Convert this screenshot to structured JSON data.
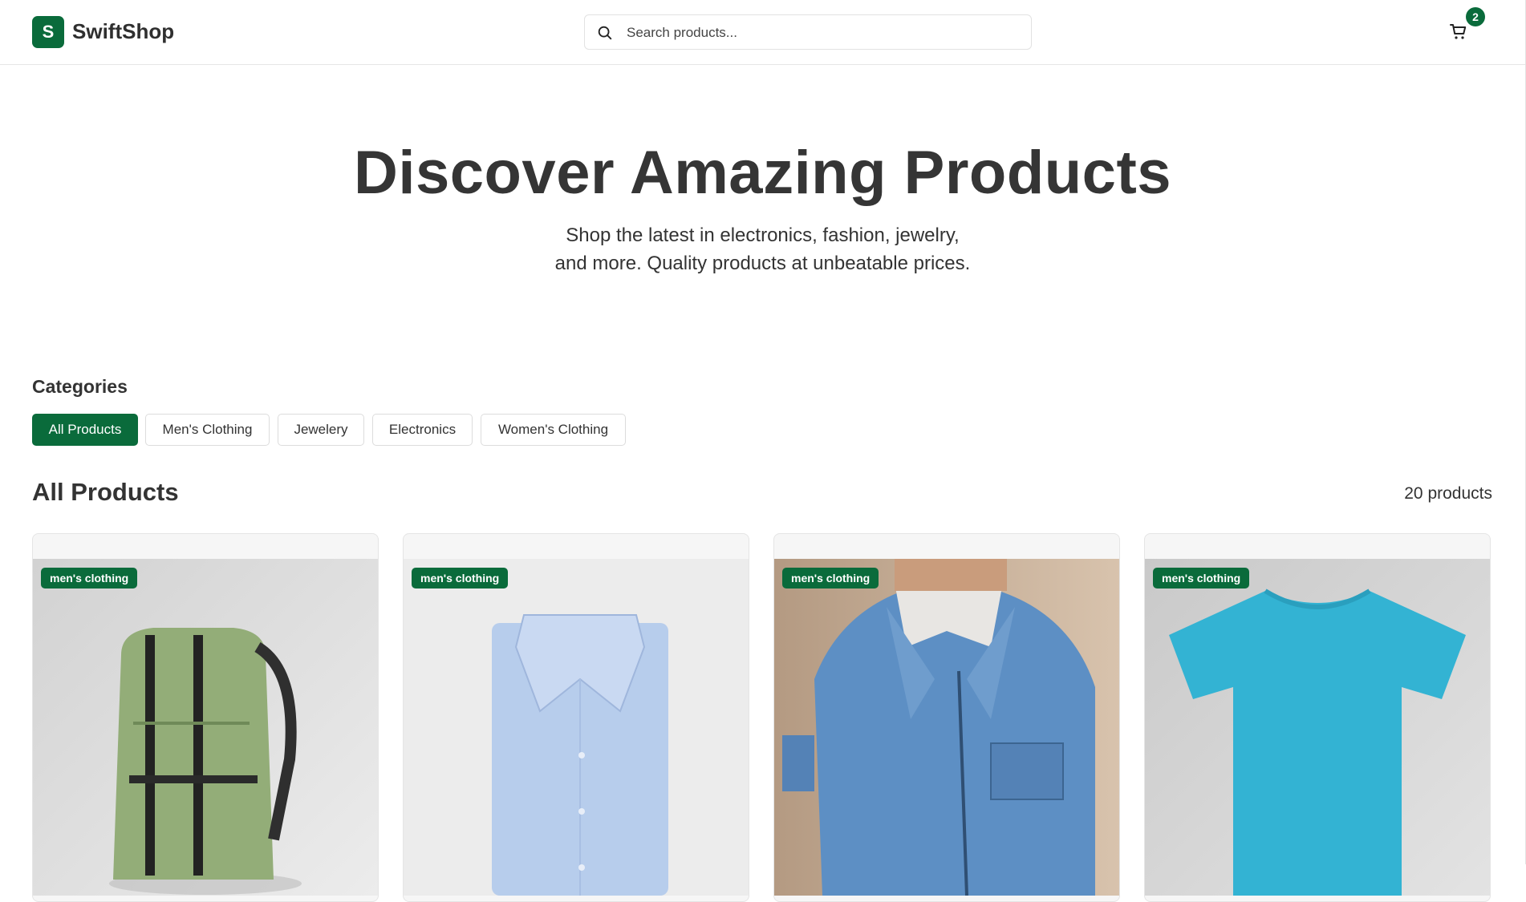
{
  "header": {
    "logo_letter": "S",
    "brand": "SwiftShop",
    "search_placeholder": "Search products...",
    "cart_count": "2"
  },
  "hero": {
    "title": "Discover Amazing Products",
    "subtitle_line1": "Shop the latest in electronics, fashion, jewelry,",
    "subtitle_line2": "and more. Quality products at unbeatable prices."
  },
  "categories": {
    "title": "Categories",
    "items": [
      "All Products",
      "Men's Clothing",
      "Jewelery",
      "Electronics",
      "Women's Clothing"
    ],
    "active": "All Products"
  },
  "products": {
    "title": "All Products",
    "count_label": "20 products",
    "cards": [
      {
        "category": "men's clothing",
        "image": "green-backpack"
      },
      {
        "category": "men's clothing",
        "image": "light-blue-dress-shirt"
      },
      {
        "category": "men's clothing",
        "image": "denim-jacket"
      },
      {
        "category": "men's clothing",
        "image": "cyan-tshirt"
      }
    ]
  },
  "colors": {
    "accent": "#0a6b3b",
    "text": "#2f2f2f"
  }
}
